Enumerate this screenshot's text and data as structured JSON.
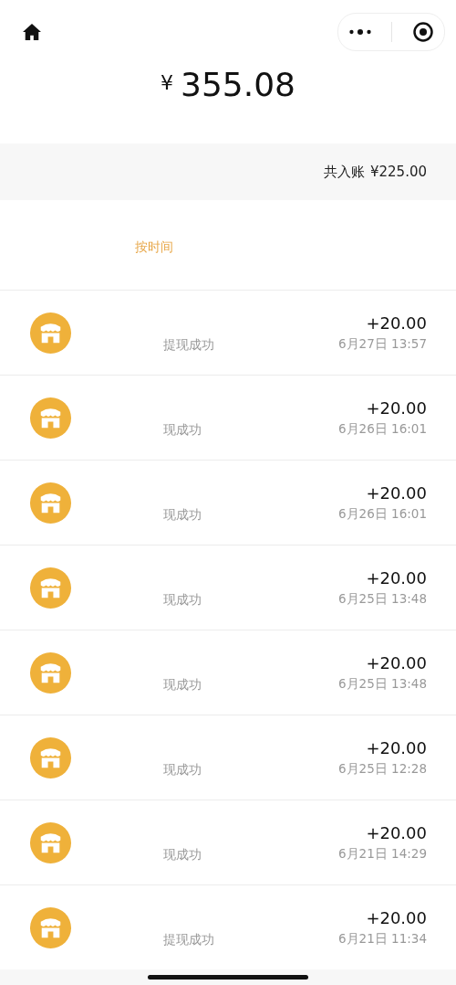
{
  "balance": {
    "currency": "¥",
    "amount": "355.08"
  },
  "summary": {
    "label": "共入账",
    "amount": "¥225.00"
  },
  "filter": {
    "label": "按时间"
  },
  "records": [
    {
      "status": "提现成功",
      "amount": "+20.00",
      "time": "6月27日 13:57"
    },
    {
      "status": "现成功",
      "amount": "+20.00",
      "time": "6月26日 16:01"
    },
    {
      "status": "现成功",
      "amount": "+20.00",
      "time": "6月26日 16:01"
    },
    {
      "status": "现成功",
      "amount": "+20.00",
      "time": "6月25日 13:48"
    },
    {
      "status": "现成功",
      "amount": "+20.00",
      "time": "6月25日 13:48"
    },
    {
      "status": "现成功",
      "amount": "+20.00",
      "time": "6月25日 12:28"
    },
    {
      "status": "现成功",
      "amount": "+20.00",
      "time": "6月21日 14:29"
    },
    {
      "status": "提现成功",
      "amount": "+20.00",
      "time": "6月21日 11:34"
    }
  ]
}
